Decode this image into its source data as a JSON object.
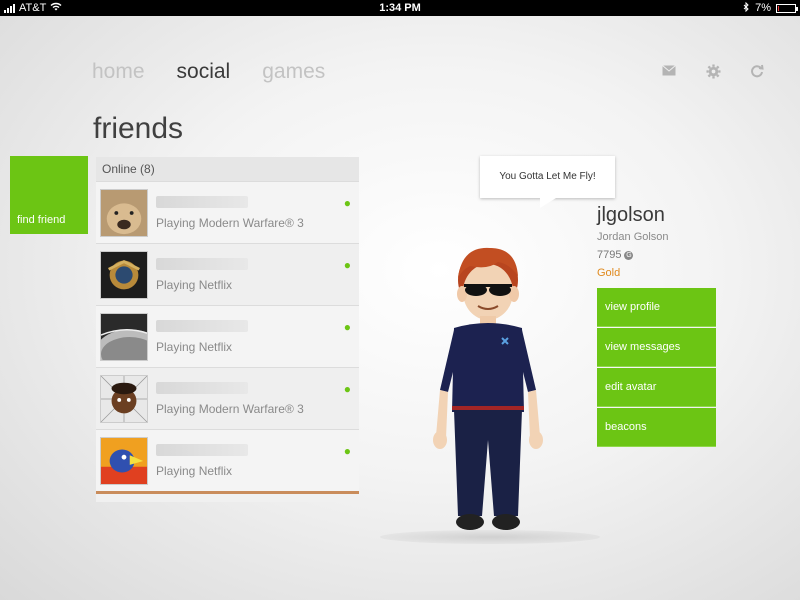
{
  "status_bar": {
    "carrier": "AT&T",
    "time": "1:34 PM",
    "battery": "7%",
    "battery_level": 0.07
  },
  "nav": {
    "items": [
      {
        "label": "home",
        "active": false
      },
      {
        "label": "social",
        "active": true
      },
      {
        "label": "games",
        "active": false
      }
    ],
    "icons": [
      "mail-icon",
      "gear-icon",
      "refresh-icon"
    ]
  },
  "page_title": "friends",
  "find_friend": {
    "label": "find friend"
  },
  "friends": {
    "online_header": "Online (8)",
    "rows": [
      {
        "status": "Playing Modern Warfare® 3"
      },
      {
        "status": "Playing Netflix"
      },
      {
        "status": "Playing Netflix"
      },
      {
        "status": "Playing Modern Warfare® 3"
      },
      {
        "status": "Playing Netflix"
      }
    ]
  },
  "bubble": {
    "text": "You Gotta Let Me Fly!"
  },
  "profile": {
    "gamertag": "jlgolson",
    "real_name": "Jordan Golson",
    "gamerscore": "7795",
    "tier": "Gold"
  },
  "actions": [
    {
      "label": "view profile"
    },
    {
      "label": "view messages"
    },
    {
      "label": "edit avatar"
    },
    {
      "label": "beacons"
    }
  ],
  "colors": {
    "accent": "#6cc514",
    "tier_gold": "#e08a1e"
  }
}
